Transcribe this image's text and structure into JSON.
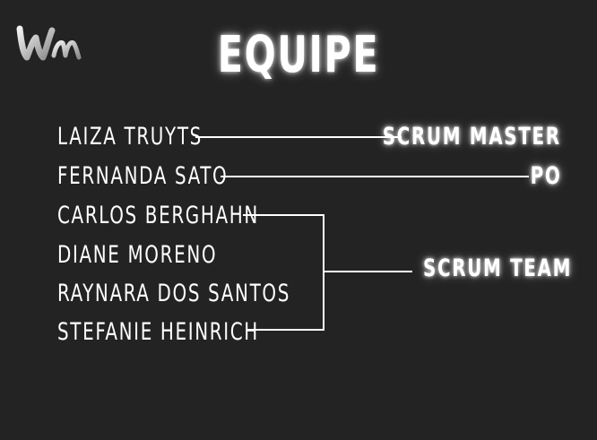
{
  "title": "EQUIPE",
  "members": [
    "LAIZA TRUYTS",
    "FERNANDA SATO",
    "CARLOS BERGHAHN",
    "DIANE MORENO",
    "RAYNARA DOS SANTOS",
    "STEFANIE HEINRICH"
  ],
  "roles": {
    "scrum_master": "SCRUM MASTER",
    "po": "PO",
    "scrum_team": "SCRUM TEAM"
  },
  "colors": {
    "background": "#232323",
    "text": "#ffffff",
    "line": "#ffffff"
  }
}
